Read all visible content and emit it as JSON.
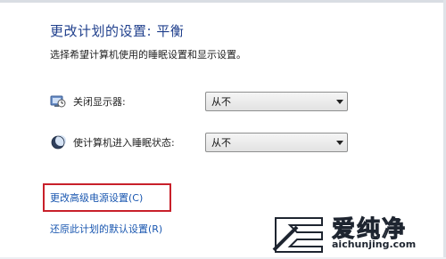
{
  "header": {
    "title": "更改计划的设置: 平衡",
    "subtitle": "选择希望计算机使用的睡眠设置和显示设置。"
  },
  "settings": [
    {
      "label": "关闭显示器:",
      "value": "从不",
      "icon": "monitor-clock-icon"
    },
    {
      "label": "使计算机进入睡眠状态:",
      "value": "从不",
      "icon": "moon-sleep-icon"
    }
  ],
  "links": {
    "advanced": "更改高级电源设置(C)",
    "restore": "还原此计划的默认设置(R)"
  },
  "watermark": {
    "brand": "爱纯净",
    "url": "aichunjing.com"
  },
  "colors": {
    "title": "#1f3f8c",
    "link": "#1a57b0",
    "highlight": "#c8202a"
  }
}
